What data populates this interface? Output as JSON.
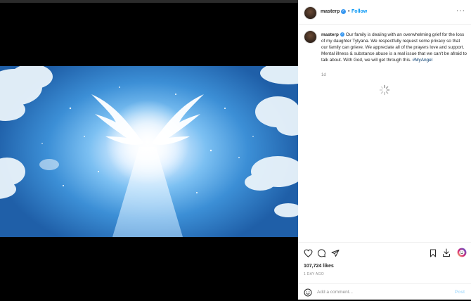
{
  "post": {
    "username": "masterp",
    "follow_label": "Follow",
    "separator": "•",
    "more_label": "···",
    "caption_text": "Our family is dealing with an overwhelming grief for the loss of my daughter Tytyana. We respectfully request some privacy so that our family can grieve. We appreciate all of the prayers love and support. Mental illness & substance abuse is a real issue that we can't be afraid to talk about. With God, we will get through this.",
    "hashtag": "#MyAngel",
    "caption_age": "1d",
    "likes": "107,724 likes",
    "time_ago": "1 DAY AGO",
    "comment_placeholder": "Add a comment...",
    "post_label": "Post"
  },
  "icons": [
    "heart-icon",
    "comment-icon",
    "share-icon",
    "bookmark-icon",
    "download-icon",
    "emoji-icon",
    "verified-badge-icon",
    "loading-spinner-icon"
  ],
  "colors": {
    "accent": "#0095f6",
    "verified": "#3897f0",
    "text": "#262626",
    "muted": "#8e8e8e",
    "post_disabled": "#b2dffc"
  }
}
